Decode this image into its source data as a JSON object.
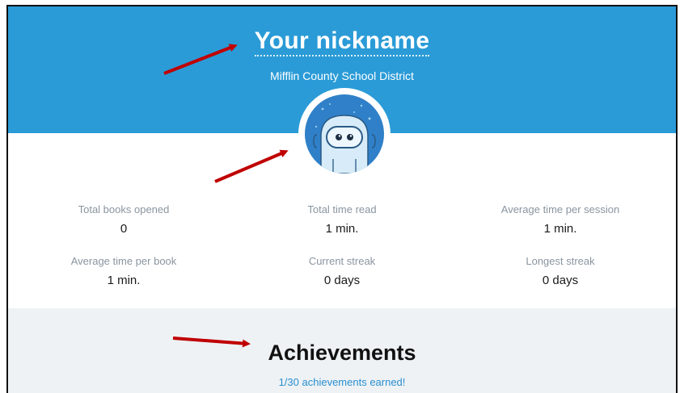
{
  "header": {
    "nickname": "Your nickname",
    "district": "Mifflin County School District"
  },
  "avatar": {
    "icon": "robot-avatar-icon"
  },
  "stats": [
    {
      "label": "Total books opened",
      "value": "0"
    },
    {
      "label": "Total time read",
      "value": "1 min."
    },
    {
      "label": "Average time per session",
      "value": "1 min."
    },
    {
      "label": "Average time per book",
      "value": "1 min."
    },
    {
      "label": "Current streak",
      "value": "0 days"
    },
    {
      "label": "Longest streak",
      "value": "0 days"
    }
  ],
  "achievements": {
    "title": "Achievements",
    "earned": "1/30 achievements earned!"
  },
  "colors": {
    "header": "#2a9bd7",
    "arrow": "#c00000",
    "link": "#2a8fd0",
    "achievements_bg": "#eef2f5"
  }
}
